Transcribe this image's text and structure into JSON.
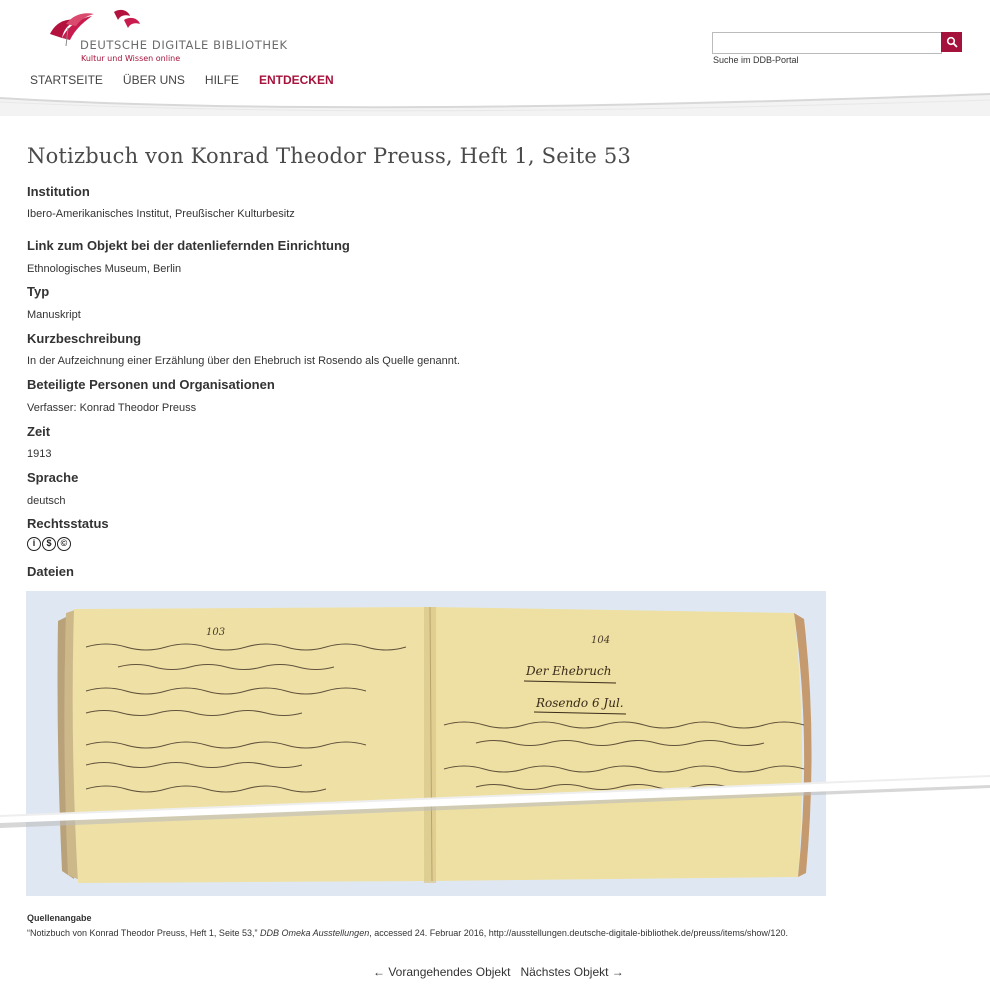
{
  "header": {
    "logo_title": "DEUTSCHE DIGITALE BIBLIOTHEK",
    "logo_subtitle": "Kultur und Wissen online",
    "search_value": "",
    "search_hint": "Suche im DDB-Portal",
    "search_icon": "search-icon"
  },
  "nav": {
    "items": [
      "STARTSEITE",
      "ÜBER UNS",
      "HILFE",
      "ENTDECKEN"
    ],
    "active": "ENTDECKEN"
  },
  "page": {
    "title": "Notizbuch von Konrad Theodor Preuss, Heft 1, Seite 53",
    "fields": [
      {
        "label": "Institution",
        "value": "Ibero-Amerikanisches Institut, Preußischer Kulturbesitz"
      },
      {
        "label": "Link zum Objekt bei der datenliefernden Einrichtung",
        "value": "Ethnologisches Museum, Berlin"
      },
      {
        "label": "Typ",
        "value": "Manuskript"
      },
      {
        "label": "Kurzbeschreibung",
        "value": "In der Aufzeichnung einer Erzählung über den Ehebruch ist Rosendo als Quelle genannt."
      },
      {
        "label": "Beteiligte Personen und Organisationen",
        "value": "Verfasser: Konrad Theodor Preuss"
      },
      {
        "label": "Zeit",
        "value": "1913"
      },
      {
        "label": "Sprache",
        "value": "deutsch"
      },
      {
        "label": "Rechtsstatus",
        "value": ""
      },
      {
        "label": "Dateien",
        "value": ""
      }
    ],
    "license_icons": [
      "cc-by-icon",
      "cc-nc-icon",
      "cc-sa-icon"
    ]
  },
  "image": {
    "page_left": "103",
    "page_right": "104",
    "heading": "Der Ehebruch",
    "subheading": "Rosendo 6 Jul."
  },
  "source": {
    "label": "Quellenangabe",
    "prefix": "“Notizbuch von Konrad Theodor Preuss, Heft 1, Seite 53,”",
    "italic": "DDB Omeka Ausstellungen",
    "suffix": ", accessed 24. Februar 2016, http://ausstellungen.deutsche-digitale-bibliothek.de/preuss/items/show/120."
  },
  "pager": {
    "prev": "← Vorangehendes Objekt",
    "next": "Nächstes Objekt →"
  },
  "colors": {
    "brand": "#a5123b",
    "paper": "#efe1a6"
  }
}
